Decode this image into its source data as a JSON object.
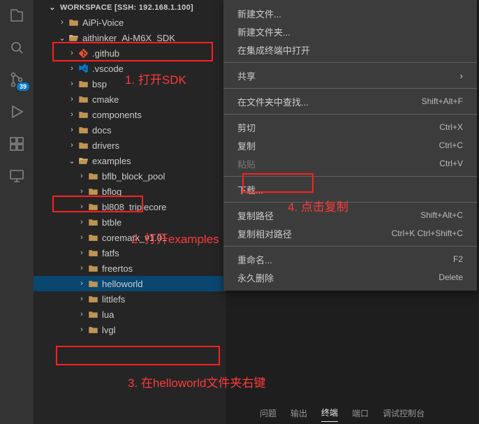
{
  "badge": "39",
  "workspace_header": "WORKSPACE [SSH: 192.168.1.100]",
  "tree": [
    {
      "depth": 0,
      "chev": "›",
      "icon": "folder",
      "label": "AiPi-Voice"
    },
    {
      "depth": 0,
      "chev": "⌄",
      "icon": "folder-open",
      "label": "aithinker_Ai-M6X_SDK"
    },
    {
      "depth": 1,
      "chev": "›",
      "icon": "git",
      "label": ".github"
    },
    {
      "depth": 1,
      "chev": "›",
      "icon": "vsc",
      "label": ".vscode"
    },
    {
      "depth": 1,
      "chev": "›",
      "icon": "folder",
      "label": "bsp"
    },
    {
      "depth": 1,
      "chev": "›",
      "icon": "folder",
      "label": "cmake"
    },
    {
      "depth": 1,
      "chev": "›",
      "icon": "folder",
      "label": "components"
    },
    {
      "depth": 1,
      "chev": "›",
      "icon": "folder",
      "label": "docs"
    },
    {
      "depth": 1,
      "chev": "›",
      "icon": "folder",
      "label": "drivers"
    },
    {
      "depth": 1,
      "chev": "⌄",
      "icon": "folder-open",
      "label": "examples"
    },
    {
      "depth": 2,
      "chev": "›",
      "icon": "folder",
      "label": "bflb_block_pool"
    },
    {
      "depth": 2,
      "chev": "›",
      "icon": "folder",
      "label": "bflog"
    },
    {
      "depth": 2,
      "chev": "›",
      "icon": "folder",
      "label": "bl808_triplecore"
    },
    {
      "depth": 2,
      "chev": "›",
      "icon": "folder",
      "label": "btble"
    },
    {
      "depth": 2,
      "chev": "›",
      "icon": "folder",
      "label": "coremark_v1.01"
    },
    {
      "depth": 2,
      "chev": "›",
      "icon": "folder",
      "label": "fatfs"
    },
    {
      "depth": 2,
      "chev": "›",
      "icon": "folder",
      "label": "freertos"
    },
    {
      "depth": 2,
      "chev": "›",
      "icon": "folder",
      "label": "helloworld",
      "sel": true
    },
    {
      "depth": 2,
      "chev": "›",
      "icon": "folder",
      "label": "littlefs"
    },
    {
      "depth": 2,
      "chev": "›",
      "icon": "folder",
      "label": "lua"
    },
    {
      "depth": 2,
      "chev": "›",
      "icon": "folder",
      "label": "lvgl"
    }
  ],
  "ctx": [
    {
      "t": "item",
      "label": "新建文件..."
    },
    {
      "t": "item",
      "label": "新建文件夹..."
    },
    {
      "t": "item",
      "label": "在集成终端中打开"
    },
    {
      "t": "sep"
    },
    {
      "t": "item",
      "label": "共享",
      "arrow": true
    },
    {
      "t": "sep"
    },
    {
      "t": "item",
      "label": "在文件夹中查找...",
      "key": "Shift+Alt+F"
    },
    {
      "t": "sep"
    },
    {
      "t": "item",
      "label": "剪切",
      "key": "Ctrl+X"
    },
    {
      "t": "item",
      "label": "复制",
      "key": "Ctrl+C"
    },
    {
      "t": "item",
      "label": "粘贴",
      "key": "Ctrl+V",
      "disabled": true
    },
    {
      "t": "sep"
    },
    {
      "t": "item",
      "label": "下载..."
    },
    {
      "t": "sep"
    },
    {
      "t": "item",
      "label": "复制路径",
      "key": "Shift+Alt+C"
    },
    {
      "t": "item",
      "label": "复制相对路径",
      "key": "Ctrl+K Ctrl+Shift+C"
    },
    {
      "t": "sep"
    },
    {
      "t": "item",
      "label": "重命名...",
      "key": "F2"
    },
    {
      "t": "item",
      "label": "永久删除",
      "key": "Delete"
    }
  ],
  "anno": {
    "a1": "1. 打开SDK",
    "a2": "2. 打开examples",
    "a3": "3. 在helloworld文件夹右键",
    "a4": "4. 点击复制"
  },
  "panel": [
    "问题",
    "输出",
    "终端",
    "端口",
    "调试控制台"
  ]
}
